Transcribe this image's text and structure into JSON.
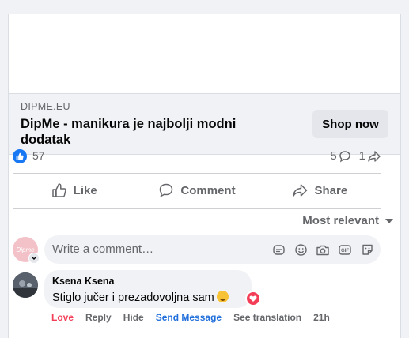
{
  "ad": {
    "domain": "DIPME.EU",
    "title": "DipMe - manikura je najbolji modni dodatak",
    "cta_label": "Shop now"
  },
  "stats": {
    "likes": "57",
    "comments": "5",
    "shares": "1"
  },
  "actions": {
    "like": "Like",
    "comment": "Comment",
    "share": "Share"
  },
  "sort": {
    "label": "Most relevant"
  },
  "composer": {
    "placeholder": "Write a comment…",
    "avatar_text": "Dipme"
  },
  "comments": [
    {
      "author": "Ksena Ksena",
      "text": "Stiglo jučer i prezadovoljna sam",
      "reaction": "heart",
      "actions": {
        "love": "Love",
        "reply": "Reply",
        "hide": "Hide",
        "send_message": "Send Message",
        "see_translation": "See translation"
      },
      "time": "21h"
    }
  ],
  "colors": {
    "accent": "#1877f2",
    "love": "#f33e58",
    "send_message": "#216fdb",
    "muted": "#65676b"
  },
  "icons": [
    "like-badge-icon",
    "comment-icon",
    "share-icon",
    "thumbs-up-icon",
    "speech-bubble-icon",
    "share-arrow-icon",
    "sticker-icon",
    "emoji-icon",
    "camera-icon",
    "gif-icon",
    "avatar-sticker-icon",
    "heart-icon",
    "chevron-down-icon"
  ]
}
